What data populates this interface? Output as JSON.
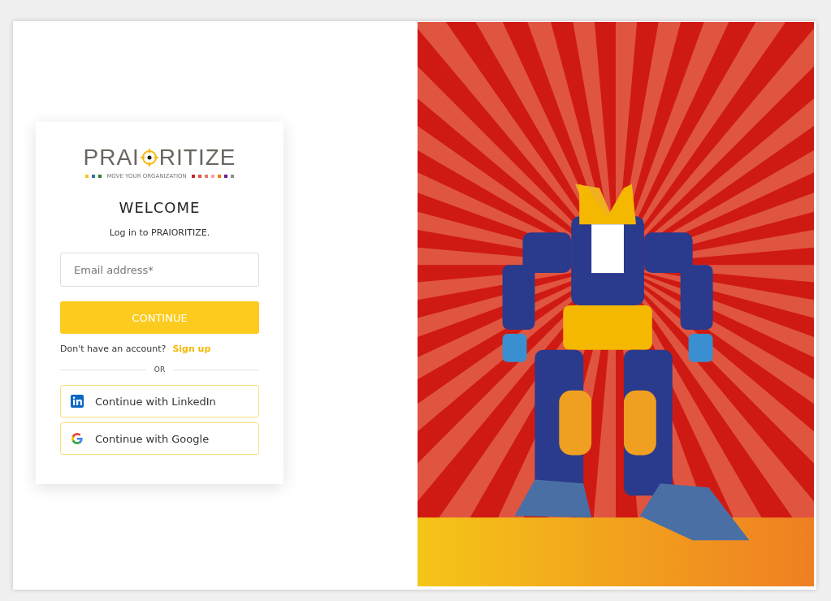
{
  "logo": {
    "left": "PRAI",
    "right": "RITIZE",
    "tagline": "MOVE YOUR ORGANIZATION",
    "left_squares": [
      {
        "color": "#f5c518"
      },
      {
        "color": "#3a6ea5"
      },
      {
        "color": "#2e7d32"
      }
    ],
    "right_squares": [
      {
        "color": "#c62828"
      },
      {
        "color": "#e0533d"
      },
      {
        "color": "#e57373"
      },
      {
        "color": "#f4a6a6"
      },
      {
        "color": "#f57c00"
      },
      {
        "color": "#6a1b9a"
      },
      {
        "color": "#8d8d8d"
      }
    ]
  },
  "title": "WELCOME",
  "subtitle": "Log in to PRAIORITIZE.",
  "email": {
    "placeholder": "Email address*"
  },
  "continue_button": "CONTINUE",
  "signup": {
    "prompt": "Don't have an account?",
    "link": "Sign up"
  },
  "divider": "OR",
  "social_buttons": [
    {
      "kind": "linkedin",
      "label": "Continue with LinkedIn"
    },
    {
      "kind": "google",
      "label": "Continue with Google"
    }
  ]
}
